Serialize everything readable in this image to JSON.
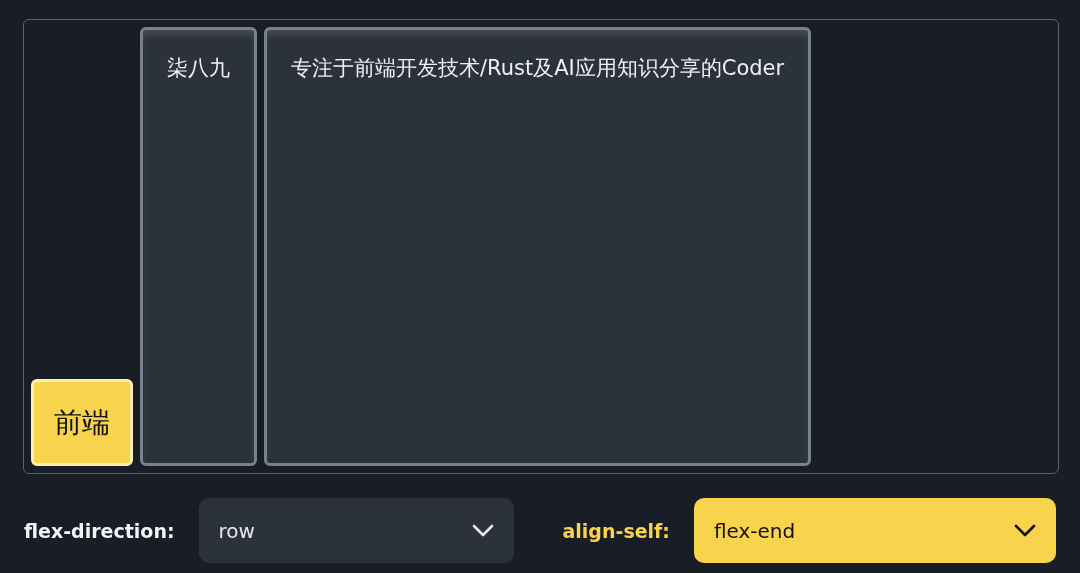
{
  "items": [
    {
      "label": "前端",
      "selected": true
    },
    {
      "label": "柒八九",
      "selected": false
    },
    {
      "label": "专注于前端开发技术/Rust及AI应用知识分享的Coder",
      "selected": false
    }
  ],
  "controls": [
    {
      "label": "flex-direction:",
      "value": "row",
      "active": false
    },
    {
      "label": "align-self:",
      "value": "flex-end",
      "active": true
    }
  ]
}
